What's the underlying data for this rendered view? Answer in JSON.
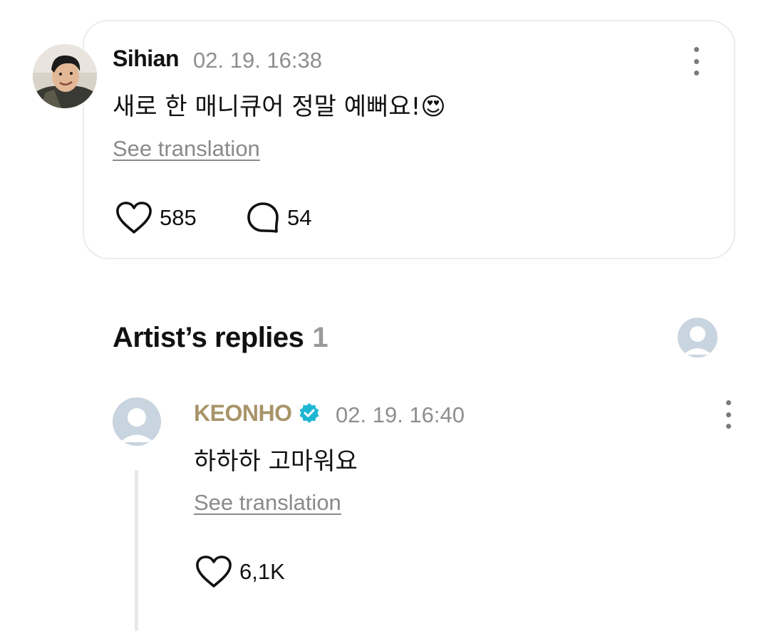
{
  "comment": {
    "author": "Sihian",
    "timestamp": "02. 19. 16:38",
    "text": "새로 한 매니큐어 정말 예뻐요!",
    "emoji": "😍",
    "translate_label": "See translation",
    "likes": "585",
    "replies": "54"
  },
  "artist_replies": {
    "title": "Artist’s replies",
    "count": "1",
    "items": [
      {
        "author": "KEONHO",
        "verified": true,
        "timestamp": "02. 19. 16:40",
        "text": "하하하 고마워요",
        "translate_label": "See translation",
        "likes": "6,1K"
      }
    ]
  },
  "colors": {
    "artist_name": "#a8946a",
    "verified_badge": "#1fb6d3",
    "muted_text": "#8e8e8e",
    "avatar_placeholder": "#c8d4df"
  }
}
